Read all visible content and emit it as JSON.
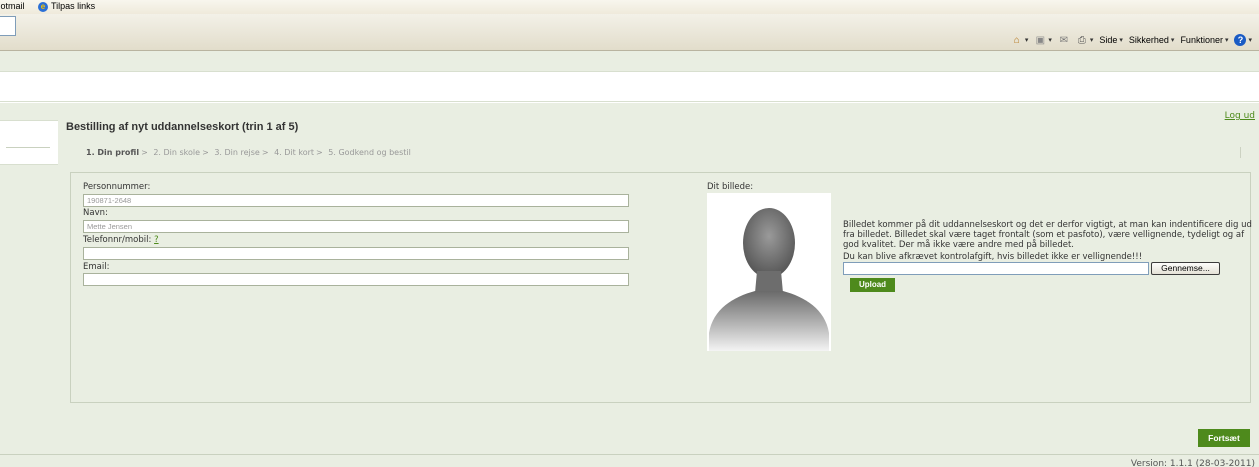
{
  "browser": {
    "favorites": [
      {
        "label": "Hotmail"
      },
      {
        "label": "Tilpas links"
      }
    ],
    "toolbar": {
      "side_label": "Side",
      "security_label": "Sikkerhed",
      "functions_label": "Funktioner"
    }
  },
  "page": {
    "logout_label": "Log ud",
    "title": "Bestilling af nyt uddannelseskort (trin 1 af 5)",
    "steps": [
      {
        "label": "1. Din profil",
        "active": true
      },
      {
        "label": "2. Din skole",
        "active": false
      },
      {
        "label": "3. Din rejse",
        "active": false
      },
      {
        "label": "4. Dit kort",
        "active": false
      },
      {
        "label": "5. Godkend og bestil",
        "active": false
      }
    ],
    "step_separator": ">"
  },
  "form": {
    "cpr_label": "Personnummer:",
    "cpr_value": "190871-2648",
    "name_label": "Navn:",
    "name_value": "Mette Jensen",
    "phone_label": "Telefonnr/mobil:",
    "phone_help": "?",
    "phone_value": "",
    "email_label": "Email:",
    "email_value": ""
  },
  "photo": {
    "label": "Dit billede:",
    "description": "Billedet kommer på dit uddannelseskort og det er derfor vigtigt, at man kan indentificere dig ud fra billedet. Billedet skal være taget frontalt (som et pasfoto), være vellignende, tydeligt og af god kvalitet. Der må ikke være andre med på billedet.",
    "warning": "Du kan blive afkrævet kontrolafgift, hvis billedet ikke er vellignende!!!",
    "browse_label": "Gennemse...",
    "upload_label": "Upload"
  },
  "actions": {
    "continue_label": "Fortsæt"
  },
  "footer": {
    "version": "Version: 1.1.1 (28-03-2011)"
  },
  "colors": {
    "accent_green": "#4e8a1c",
    "page_background": "#e9eee2"
  }
}
